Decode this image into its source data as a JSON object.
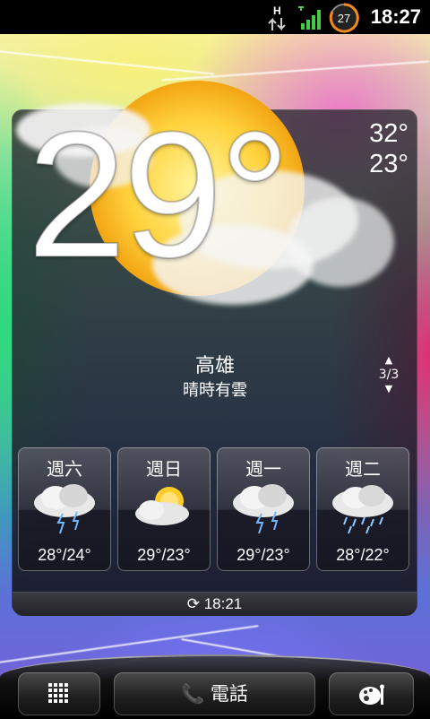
{
  "status_bar": {
    "network_type": "H",
    "notification_count": "27",
    "time": "18:27",
    "icons": [
      "data-transfer-icon",
      "signal-strength-icon",
      "battery-icon"
    ]
  },
  "weather_widget": {
    "current_temp": "29°",
    "high": "32°",
    "low": "23°",
    "city": "高雄",
    "condition": "晴時有雲",
    "page_indicator": "3/3",
    "forecast": [
      {
        "day": "週六",
        "temp": "28°/24°",
        "icon": "thunderstorm-icon"
      },
      {
        "day": "週日",
        "temp": "29°/23°",
        "icon": "partly-sunny-icon"
      },
      {
        "day": "週一",
        "temp": "29°/23°",
        "icon": "thunderstorm-icon"
      },
      {
        "day": "週二",
        "temp": "28°/22°",
        "icon": "rain-icon"
      }
    ],
    "last_update": "18:21"
  },
  "dock": {
    "phone_label": "電話"
  }
}
